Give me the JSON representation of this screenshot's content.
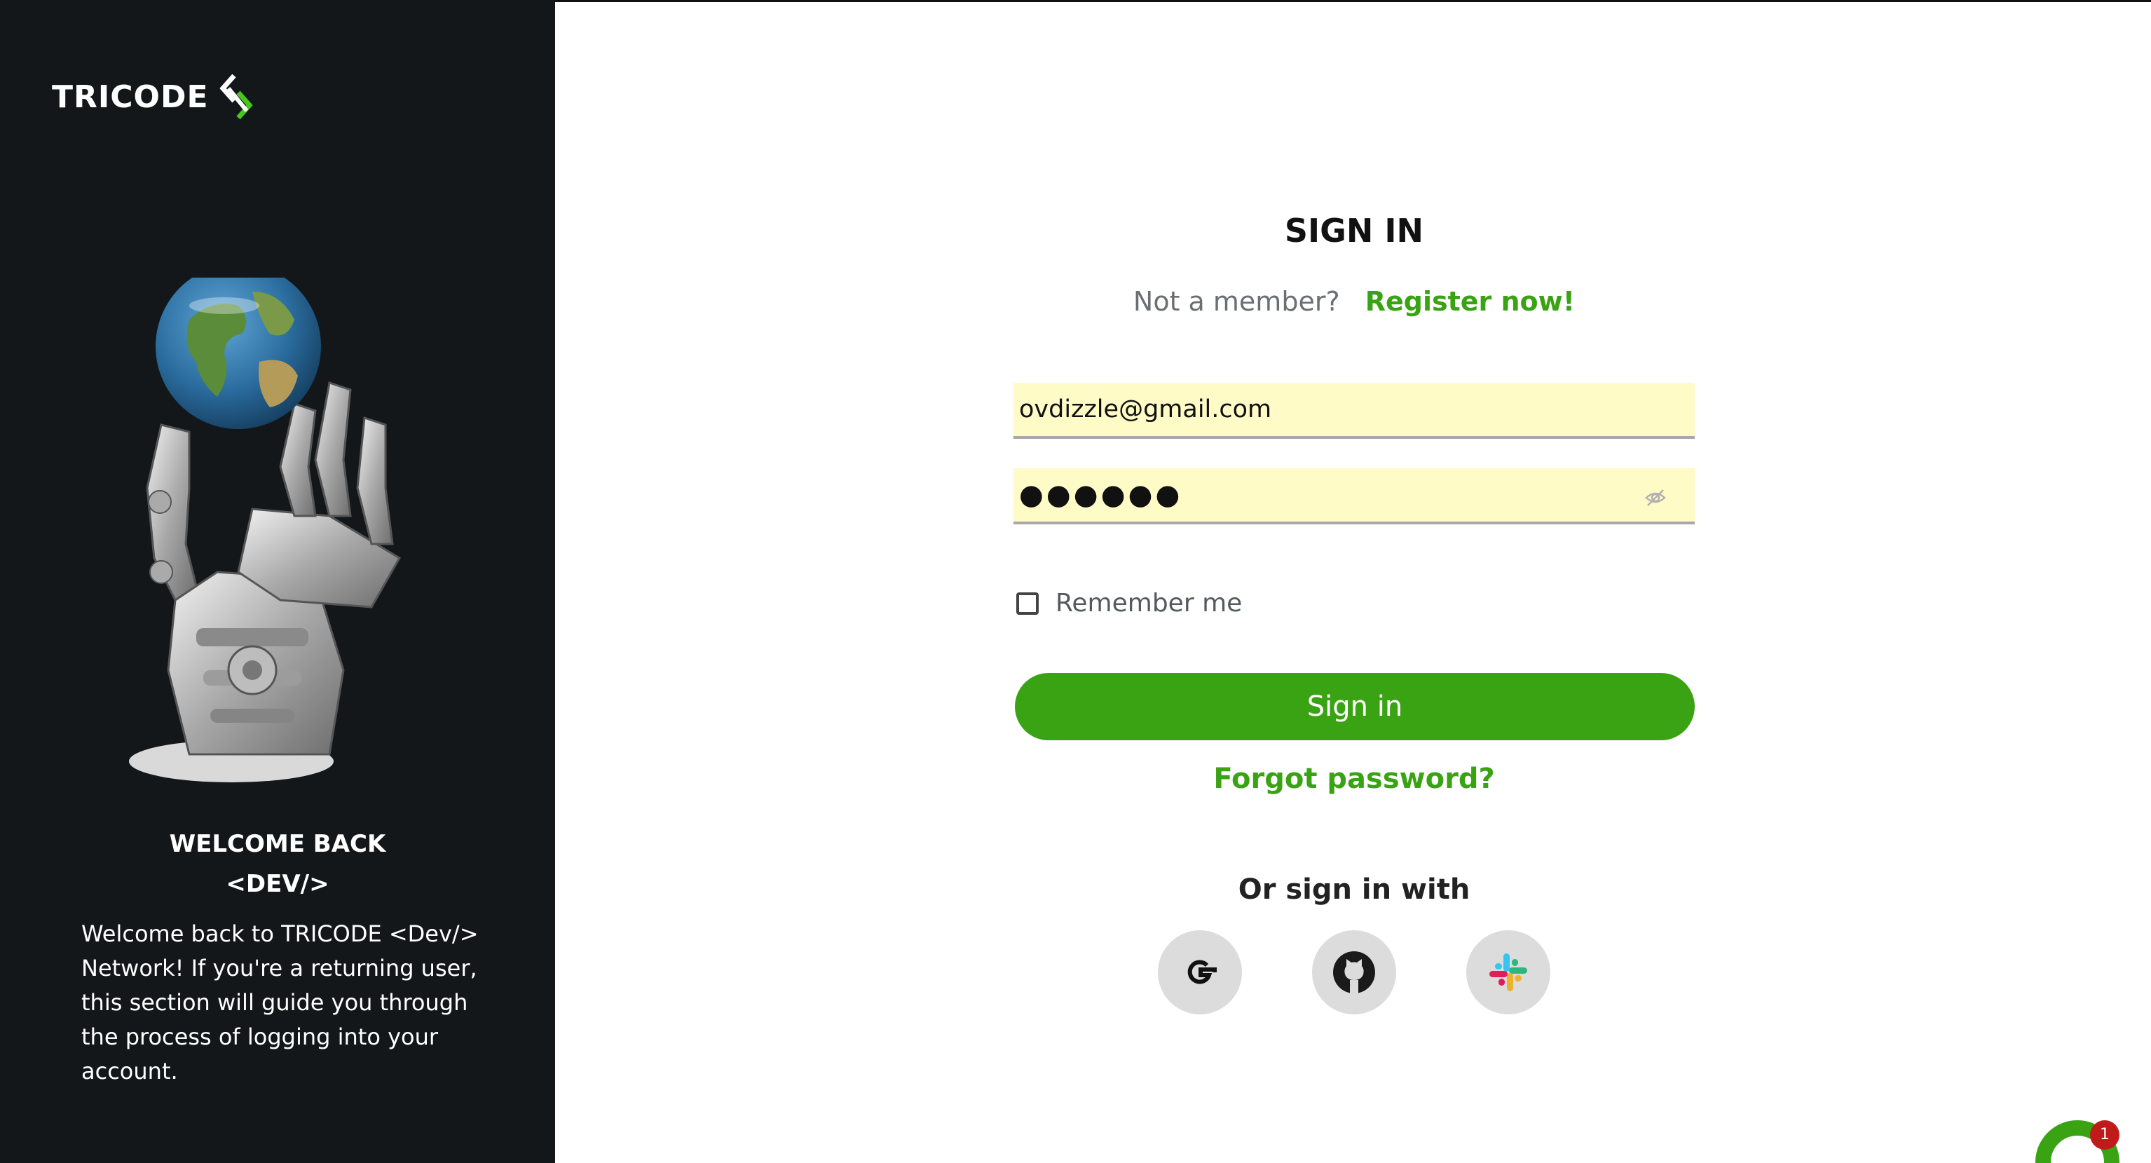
{
  "brand": {
    "name": "TRICODE"
  },
  "welcome": {
    "title_line1": "WELCOME BACK",
    "title_line2": "<DEV/>",
    "body": "Welcome back to TRICODE <Dev/> Network! If you're a returning user, this section will guide you through the process of logging into your account."
  },
  "form": {
    "title": "SIGN IN",
    "member_prompt": "Not a member?",
    "register_link": "Register now!",
    "email_value": "ovdizzle@gmail.com",
    "password_value": "●●●●●●",
    "remember_label": "Remember me",
    "remember_checked": false,
    "signin_button": "Sign in",
    "forgot_link": "Forgot password?",
    "or_sign_in_with": "Or sign in with"
  },
  "social": [
    {
      "icon": "google-icon"
    },
    {
      "icon": "github-icon"
    },
    {
      "icon": "slack-icon"
    }
  ],
  "chat": {
    "badge_count": "1"
  },
  "colors": {
    "accent": "#3aa314",
    "left_panel_bg": "#131719",
    "input_bg": "#fefbc7",
    "social_bg": "#dcdcdc",
    "badge": "#c11a1a"
  }
}
